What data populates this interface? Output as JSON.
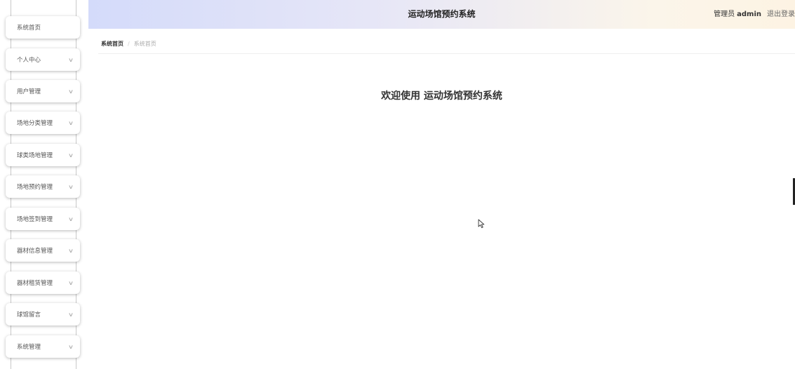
{
  "header": {
    "title": "运动场馆预约系统",
    "role": "管理员",
    "username": "admin",
    "logout_label": "退出登录"
  },
  "breadcrumb": {
    "home": "系统首页",
    "separator": "/",
    "current": "系统首页"
  },
  "main": {
    "welcome_text": "欢迎使用 运动场馆预约系统"
  },
  "sidebar": {
    "items": [
      {
        "label": "系统首页",
        "has_submenu": false
      },
      {
        "label": "个人中心",
        "has_submenu": true
      },
      {
        "label": "用户管理",
        "has_submenu": true
      },
      {
        "label": "场地分类管理",
        "has_submenu": true
      },
      {
        "label": "球类场地管理",
        "has_submenu": true
      },
      {
        "label": "场地预约管理",
        "has_submenu": true
      },
      {
        "label": "场地签到管理",
        "has_submenu": true
      },
      {
        "label": "器材信息管理",
        "has_submenu": true
      },
      {
        "label": "器材租赁管理",
        "has_submenu": true
      },
      {
        "label": "球馆留言",
        "has_submenu": true
      },
      {
        "label": "系统管理",
        "has_submenu": true
      }
    ]
  },
  "colors": {
    "header_gradient_start": "#d4dbfa",
    "header_gradient_end": "#fdf3e3"
  }
}
